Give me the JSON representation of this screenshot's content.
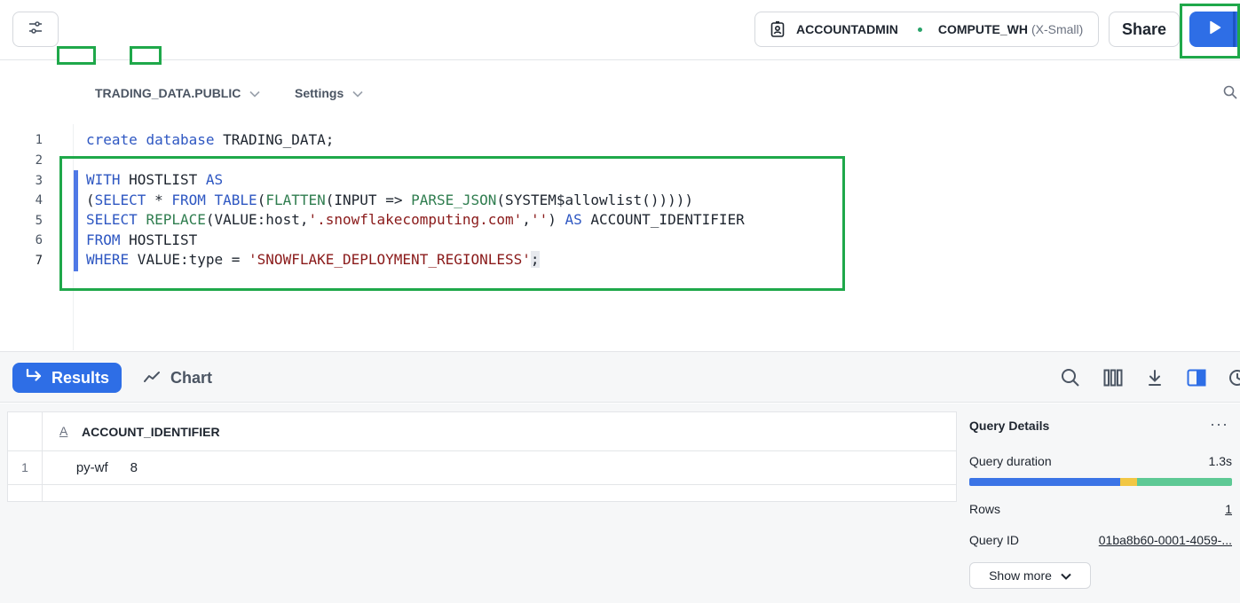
{
  "topbar": {
    "role": "ACCOUNTADMIN",
    "warehouse": "COMPUTE_WH",
    "warehouse_size": "(X-Small)",
    "share_label": "Share"
  },
  "context": {
    "database_schema": "TRADING_DATA.PUBLIC",
    "settings_label": "Settings"
  },
  "editor": {
    "line_numbers": [
      "1",
      "2",
      "3",
      "4",
      "5",
      "6",
      "7"
    ],
    "lines": [
      "create database TRADING_DATA;",
      "",
      "WITH HOSTLIST AS",
      "(SELECT * FROM TABLE(FLATTEN(INPUT => PARSE_JSON(SYSTEM$allowlist()))))",
      "SELECT REPLACE(VALUE:host,'.snowflakecomputing.com','') AS ACCOUNT_IDENTIFIER",
      "FROM HOSTLIST",
      "WHERE VALUE:type = 'SNOWFLAKE_DEPLOYMENT_REGIONLESS';"
    ]
  },
  "results": {
    "tabs": [
      "Results",
      "Chart"
    ],
    "column_type": "A",
    "column_name": "ACCOUNT_IDENTIFIER",
    "rows": [
      {
        "num": "1",
        "value": "     py-wf      8"
      }
    ]
  },
  "details": {
    "title": "Query Details",
    "more": "···",
    "duration_label": "Query duration",
    "duration_value": "1.3s",
    "duration_breakdown": [
      0.575,
      0.065,
      0.36
    ],
    "rows_label": "Rows",
    "rows_value": "1",
    "query_id_label": "Query ID",
    "query_id_value": "01ba8b60-0001-4059-...",
    "show_more_label": "Show more"
  },
  "colors": {
    "accent": "#2e6ee6",
    "highlight": "#1fa84a",
    "bar_blue": "#3b74e6",
    "bar_yellow": "#f2c744",
    "bar_green": "#5ec995"
  }
}
